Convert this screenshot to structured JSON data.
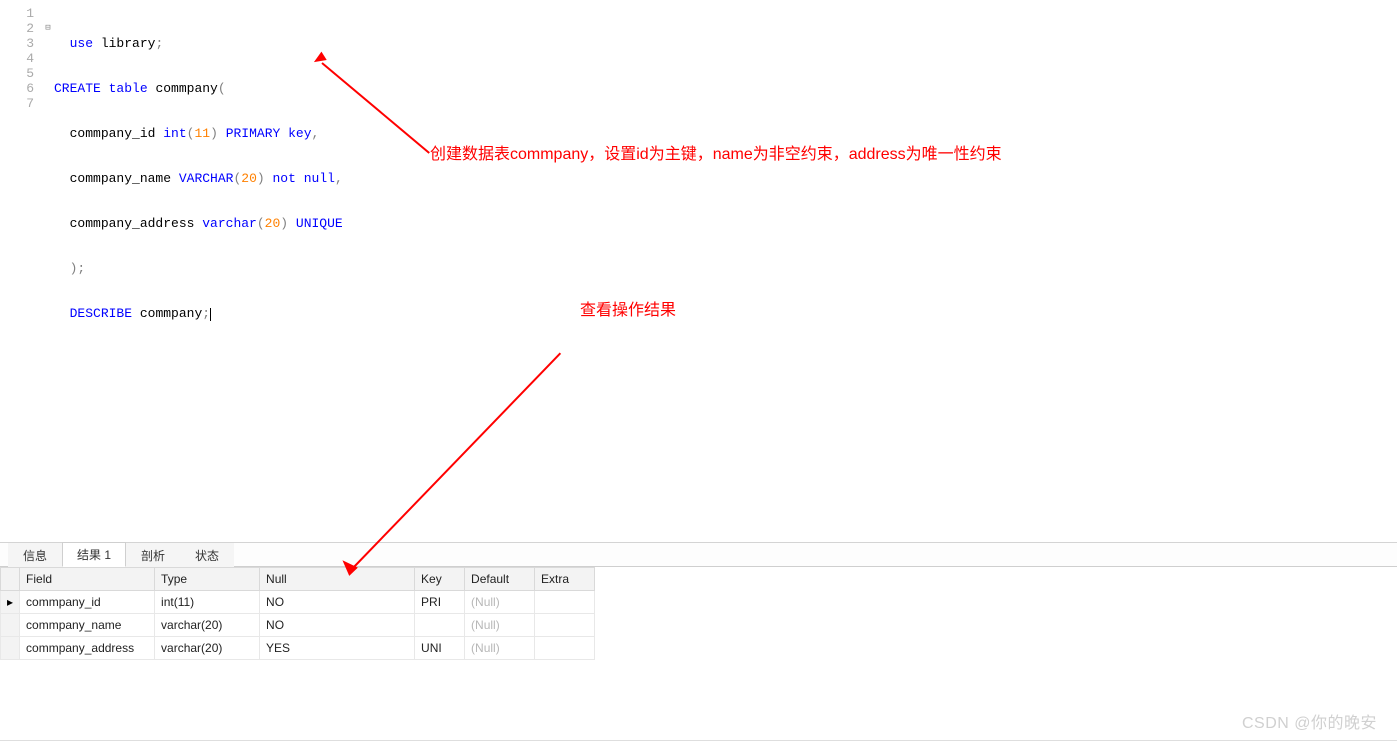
{
  "code": {
    "lines": [
      1,
      2,
      3,
      4,
      5,
      6,
      7
    ],
    "l1": {
      "use": "use",
      "lib": "library",
      "semi": ";"
    },
    "l2": {
      "create": "CREATE",
      "table": "table",
      "name": "commpany",
      "open": "("
    },
    "l3": {
      "col": "commpany_id",
      "type": "int",
      "p1": "(",
      "n": "11",
      "p2": ")",
      "pk1": "PRIMARY",
      "pk2": "key",
      "comma": ","
    },
    "l4": {
      "col": "commpany_name",
      "type": "VARCHAR",
      "p1": "(",
      "n": "20",
      "p2": ")",
      "nn1": "not",
      "nn2": "null",
      "comma": ","
    },
    "l5": {
      "col": "commpany_address",
      "type": "varchar",
      "p1": "(",
      "n": "20",
      "p2": ")",
      "uq": "UNIQUE"
    },
    "l6": {
      "close": ")",
      "semi": ";"
    },
    "l7": {
      "desc": "DESCRIBE",
      "name": "commpany",
      "semi": ";"
    }
  },
  "annotations": {
    "a1": "创建数据表commpany，设置id为主键，name为非空约束，address为唯一性约束",
    "a2": "查看操作结果"
  },
  "tabs": {
    "t0": "信息",
    "t1": "结果 1",
    "t2": "剖析",
    "t3": "状态"
  },
  "grid": {
    "headers": {
      "Field": "Field",
      "Type": "Type",
      "Null": "Null",
      "Key": "Key",
      "Default": "Default",
      "Extra": "Extra"
    },
    "rows": [
      {
        "Field": "commpany_id",
        "Type": "int(11)",
        "Null": "NO",
        "Key": "PRI",
        "Default": "(Null)",
        "Extra": ""
      },
      {
        "Field": "commpany_name",
        "Type": "varchar(20)",
        "Null": "NO",
        "Key": "",
        "Default": "(Null)",
        "Extra": ""
      },
      {
        "Field": "commpany_address",
        "Type": "varchar(20)",
        "Null": "YES",
        "Key": "UNI",
        "Default": "(Null)",
        "Extra": ""
      }
    ]
  },
  "watermark": "CSDN @你的晚安"
}
